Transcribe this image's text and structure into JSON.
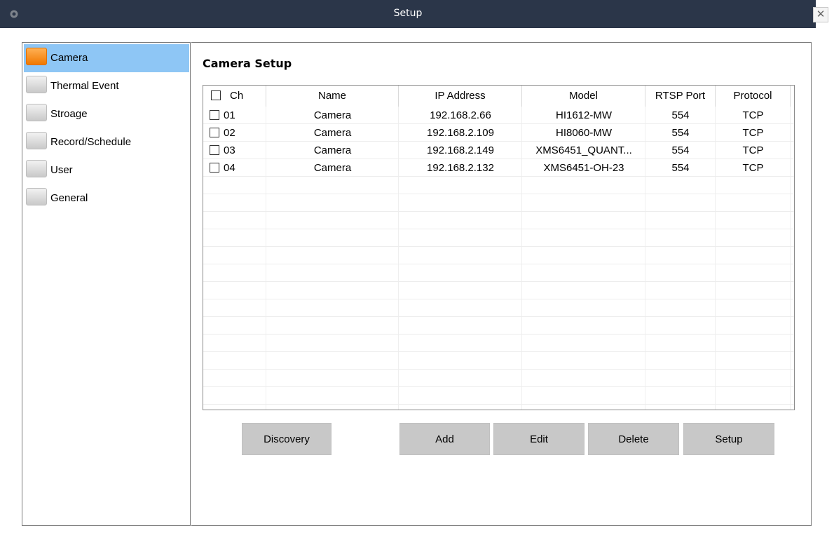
{
  "window": {
    "title": "Setup",
    "close_glyph": "✕"
  },
  "sidebar": {
    "items": [
      {
        "label": "Camera",
        "active": true
      },
      {
        "label": "Thermal Event",
        "active": false
      },
      {
        "label": "Stroage",
        "active": false
      },
      {
        "label": "Record/Schedule",
        "active": false
      },
      {
        "label": "User",
        "active": false
      },
      {
        "label": "General",
        "active": false
      }
    ]
  },
  "main": {
    "section_title": "Camera Setup",
    "table": {
      "headers": {
        "ch": "Ch",
        "name": "Name",
        "ip": "IP Address",
        "model": "Model",
        "rtsp": "RTSP Port",
        "protocol": "Protocol"
      },
      "rows": [
        {
          "ch": "01",
          "name": "Camera",
          "ip": "192.168.2.66",
          "model": "HI1612-MW",
          "rtsp": "554",
          "protocol": "TCP"
        },
        {
          "ch": "02",
          "name": "Camera",
          "ip": "192.168.2.109",
          "model": "HI8060-MW",
          "rtsp": "554",
          "protocol": "TCP"
        },
        {
          "ch": "03",
          "name": "Camera",
          "ip": "192.168.2.149",
          "model": "XMS6451_QUANT...",
          "rtsp": "554",
          "protocol": "TCP"
        },
        {
          "ch": "04",
          "name": "Camera",
          "ip": "192.168.2.132",
          "model": "XMS6451-OH-23",
          "rtsp": "554",
          "protocol": "TCP"
        }
      ]
    },
    "buttons": {
      "discovery": "Discovery",
      "add": "Add",
      "edit": "Edit",
      "delete": "Delete",
      "setup": "Setup"
    }
  },
  "colors": {
    "titlebar": "#2b3649",
    "active_nav": "#8ec6f5",
    "active_icon": "#f07800",
    "button": "#c8c8c8"
  }
}
